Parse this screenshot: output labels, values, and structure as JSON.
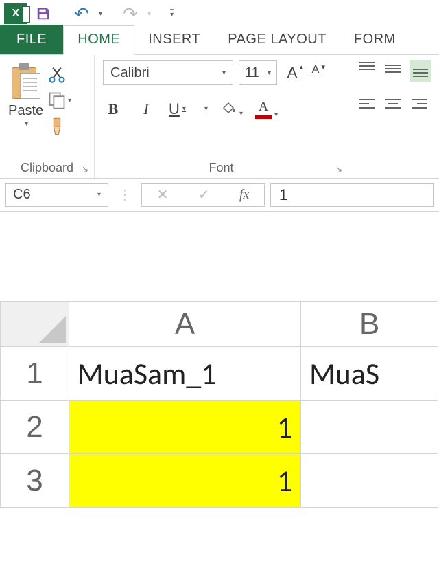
{
  "qat": {
    "undo": "↶",
    "redo": "↷"
  },
  "tabs": {
    "file": "FILE",
    "home": "HOME",
    "insert": "INSERT",
    "page_layout": "PAGE LAYOUT",
    "formulas": "FORM"
  },
  "ribbon": {
    "clipboard": {
      "paste": "Paste",
      "label": "Clipboard"
    },
    "font": {
      "name": "Calibri",
      "size": "11",
      "grow": "A",
      "shrink": "A",
      "bold": "B",
      "italic": "I",
      "underline": "U",
      "fill_color": "#ffff00",
      "font_color": "#c00000",
      "font_color_letter": "A",
      "label": "Font"
    }
  },
  "formula_bar": {
    "name_box": "C6",
    "cancel": "✕",
    "enter": "✓",
    "fx": "fx",
    "value": "1"
  },
  "sheet": {
    "col_A": "A",
    "col_B": "B",
    "row_1": "1",
    "row_2": "2",
    "row_3": "3",
    "cells": {
      "A1": "MuaSam_1",
      "B1": "MuaS",
      "A2": "1",
      "A3": "1"
    }
  },
  "glyphs": {
    "caret": "▾",
    "launcher": "↘"
  }
}
